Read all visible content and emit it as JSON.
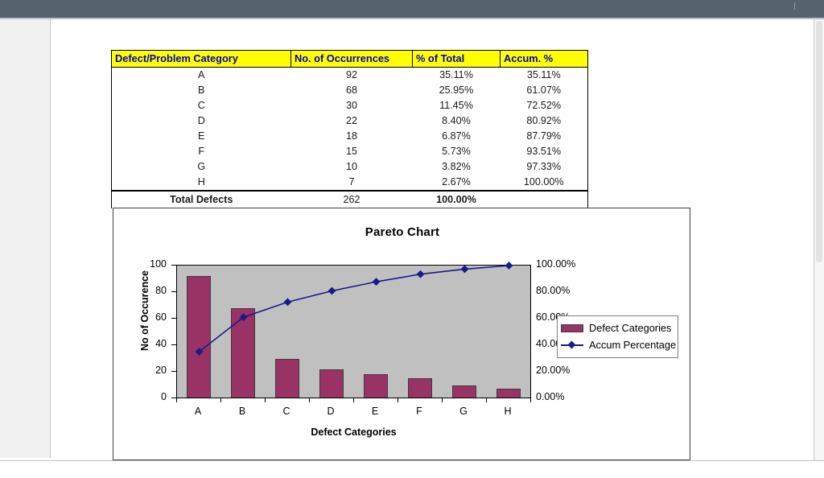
{
  "window": {
    "titlebar_color": "#56636e",
    "page_background": "#ffffff"
  },
  "table": {
    "columns": [
      "Defect/Problem Category",
      "No. of Occurrences",
      "% of Total",
      "Accum. %"
    ],
    "rows": [
      {
        "category": "A",
        "occurrences": "92",
        "pct_of_total": "35.11%",
        "accum_pct": "35.11%"
      },
      {
        "category": "B",
        "occurrences": "68",
        "pct_of_total": "25.95%",
        "accum_pct": "61.07%"
      },
      {
        "category": "C",
        "occurrences": "30",
        "pct_of_total": "11.45%",
        "accum_pct": "72.52%"
      },
      {
        "category": "D",
        "occurrences": "22",
        "pct_of_total": "8.40%",
        "accum_pct": "80.92%"
      },
      {
        "category": "E",
        "occurrences": "18",
        "pct_of_total": "6.87%",
        "accum_pct": "87.79%"
      },
      {
        "category": "F",
        "occurrences": "15",
        "pct_of_total": "5.73%",
        "accum_pct": "93.51%"
      },
      {
        "category": "G",
        "occurrences": "10",
        "pct_of_total": "3.82%",
        "accum_pct": "97.33%"
      },
      {
        "category": "H",
        "occurrences": "7",
        "pct_of_total": "2.67%",
        "accum_pct": "100.00%"
      }
    ],
    "total_row": {
      "label": "Total Defects",
      "occurrences": "262",
      "pct_of_total": "100.00%",
      "accum_pct": ""
    },
    "header_background": "#ffff00",
    "header_text_color": "#0000cc"
  },
  "chart_data": {
    "type": "bar",
    "title": "Pareto Chart",
    "xlabel": "Defect Categories",
    "ylabel": "No of Occurence",
    "y2label": "",
    "categories": [
      "A",
      "B",
      "C",
      "D",
      "E",
      "F",
      "G",
      "H"
    ],
    "series": [
      {
        "name": "Defect Categories",
        "type": "bar",
        "axis": "left",
        "color": "#993366",
        "values": [
          92,
          68,
          30,
          22,
          18,
          15,
          10,
          7
        ]
      },
      {
        "name": "Accum Percentage",
        "type": "line",
        "axis": "right",
        "color": "#1a1a8c",
        "values": [
          35.11,
          61.07,
          72.52,
          80.92,
          87.79,
          93.51,
          97.33,
          100.0
        ]
      }
    ],
    "ylim": [
      0,
      100
    ],
    "yticks": [
      "0",
      "20",
      "40",
      "60",
      "80",
      "100"
    ],
    "y2lim": [
      0,
      100
    ],
    "y2ticks": [
      "0.00%",
      "20.00%",
      "40.00%",
      "60.00%",
      "80.00%",
      "100.00%"
    ],
    "grid": false,
    "legend_position": "right",
    "legend": [
      "Defect Categories",
      "Accum Percentage"
    ],
    "plot_background": "#c0c0c0"
  }
}
